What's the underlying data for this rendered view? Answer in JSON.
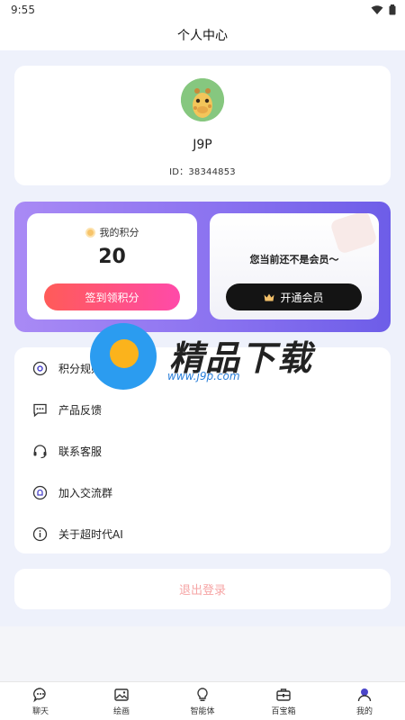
{
  "status_bar": {
    "time": "9:55"
  },
  "header": {
    "title": "个人中心"
  },
  "profile": {
    "name": "J9P",
    "id_text": "ID：38344853"
  },
  "points": {
    "label": "我的积分",
    "value": "20",
    "button_label": "签到领积分"
  },
  "vip": {
    "text": "您当前还不是会员～",
    "button_label": "开通会员"
  },
  "menu": {
    "items": [
      {
        "label": "积分规则",
        "icon": "gear-icon"
      },
      {
        "label": "产品反馈",
        "icon": "chat-icon"
      },
      {
        "label": "联系客服",
        "icon": "headset-icon"
      },
      {
        "label": "加入交流群",
        "icon": "group-icon"
      },
      {
        "label": "关于超时代AI",
        "icon": "info-icon"
      }
    ]
  },
  "logout": {
    "label": "退出登录"
  },
  "watermark": {
    "title": "精品下载",
    "url": "www.j9p.com"
  },
  "tabbar": {
    "items": [
      {
        "label": "聊天",
        "icon": "chat-icon"
      },
      {
        "label": "绘画",
        "icon": "image-icon"
      },
      {
        "label": "智能体",
        "icon": "lightbulb-icon"
      },
      {
        "label": "百宝箱",
        "icon": "toolbox-icon"
      },
      {
        "label": "我的",
        "icon": "user-icon"
      }
    ]
  },
  "colors": {
    "accent_purple": "#7b66ee",
    "points_button": "#ff5b58",
    "logout_text": "#f6a5a5",
    "tab_active": "#4b45c9"
  }
}
